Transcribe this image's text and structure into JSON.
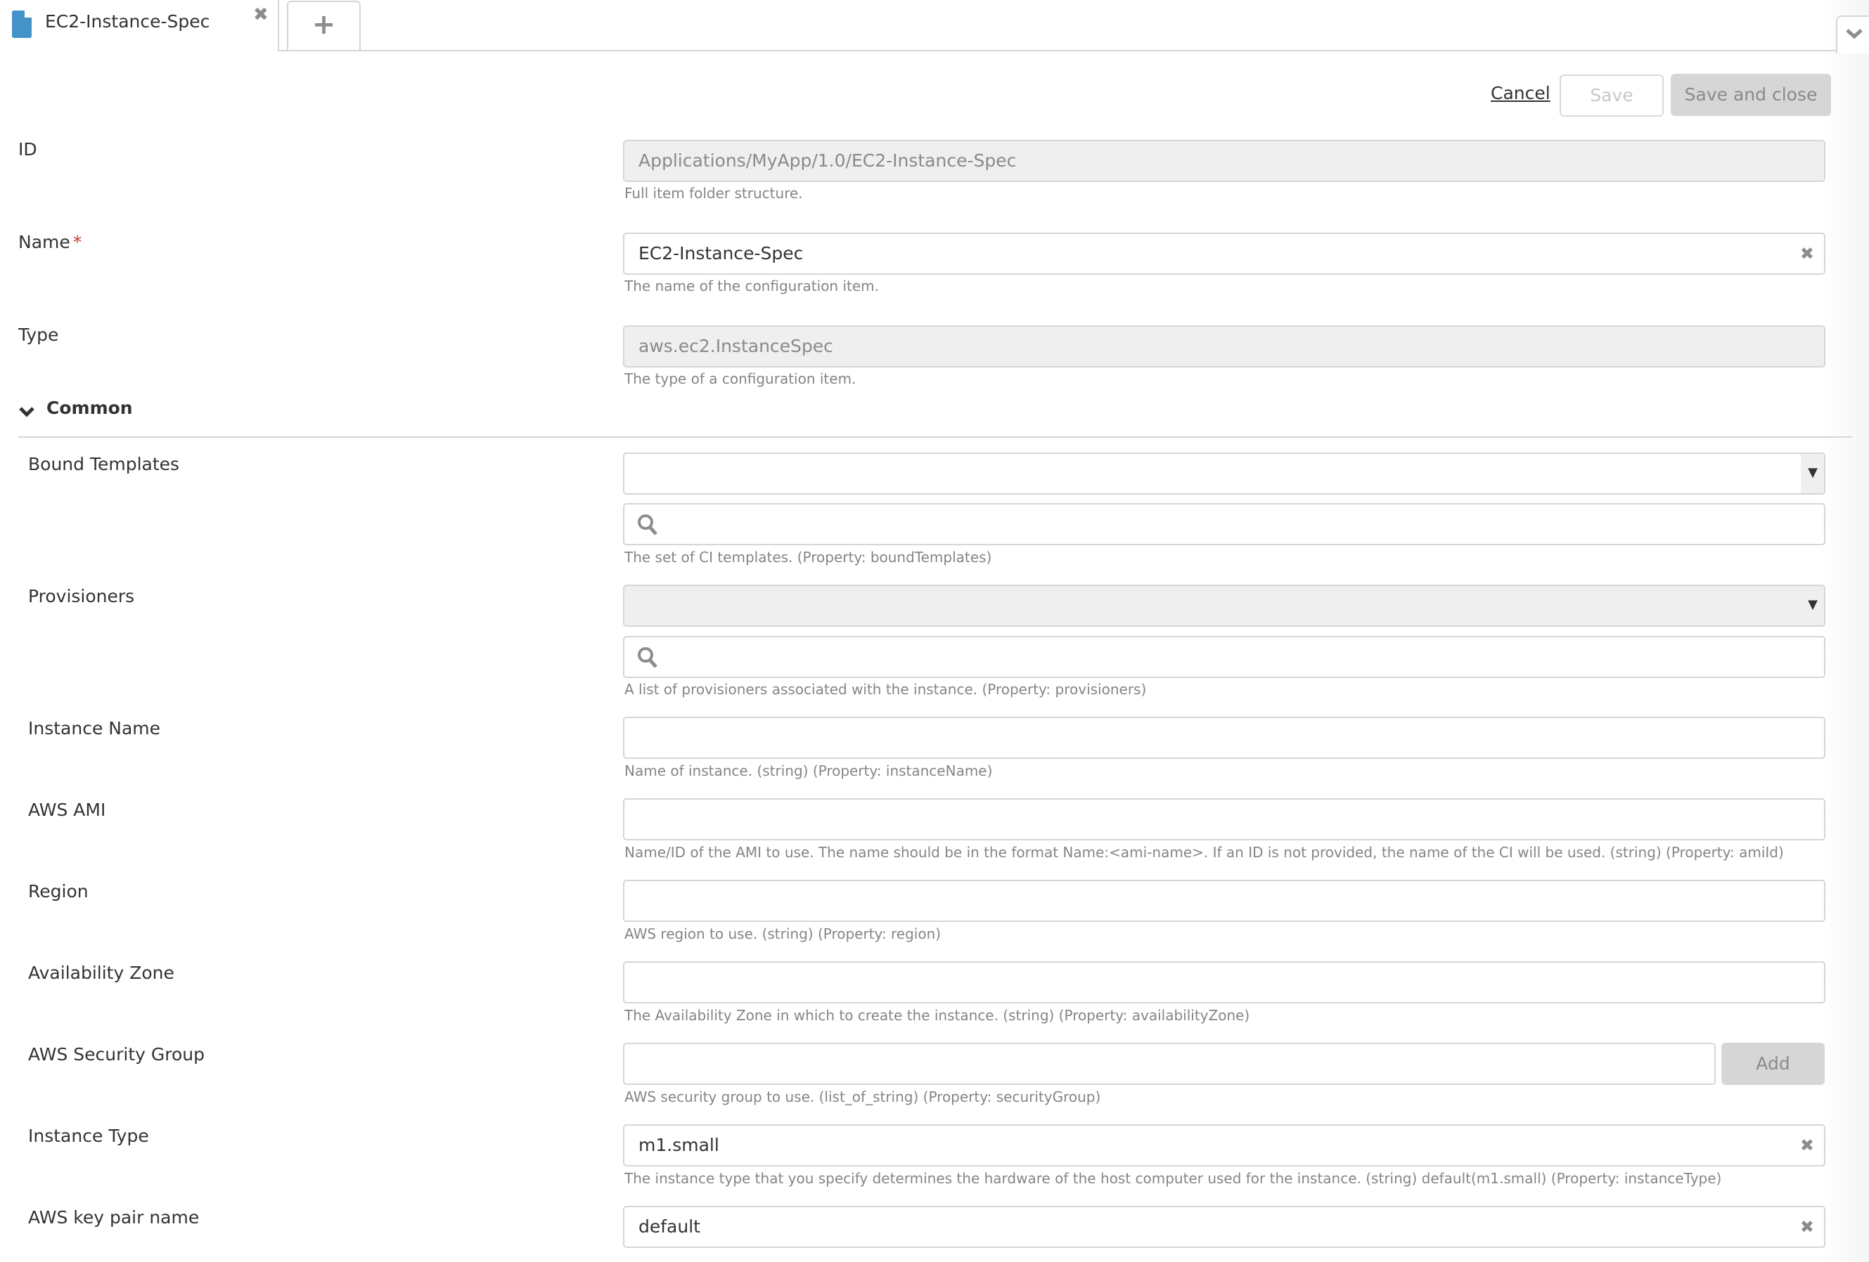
{
  "tabs": {
    "active": {
      "label": "EC2-Instance-Spec",
      "icon": "document-icon",
      "close_icon": "close-icon"
    },
    "add_icon": "plus-icon",
    "menu_icon": "chevron-down-icon"
  },
  "colors": {
    "accent": "#4393c8",
    "required": "#c0392b",
    "border": "#d6d6d6",
    "disabled_bg": "#efefef"
  },
  "actions": {
    "cancel": "Cancel",
    "save": "Save",
    "save_and_close": "Save and close"
  },
  "fields": {
    "id": {
      "label": "ID",
      "value": "Applications/MyApp/1.0/EC2-Instance-Spec",
      "helper": "Full item folder structure."
    },
    "name": {
      "label": "Name",
      "required_mark": "*",
      "value": "EC2-Instance-Spec",
      "helper": "The name of the configuration item."
    },
    "type": {
      "label": "Type",
      "value": "aws.ec2.InstanceSpec",
      "helper": "The type of a configuration item."
    }
  },
  "section": {
    "title": "Common",
    "expanded": true
  },
  "common": {
    "bound_templates": {
      "label": "Bound Templates",
      "selected": "",
      "search_value": "",
      "helper": "The set of CI templates. (Property: boundTemplates)"
    },
    "provisioners": {
      "label": "Provisioners",
      "selected": "",
      "search_value": "",
      "helper": "A list of provisioners associated with the instance. (Property: provisioners)"
    },
    "instance_name": {
      "label": "Instance Name",
      "value": "",
      "helper": "Name of instance. (string) (Property: instanceName)"
    },
    "aws_ami": {
      "label": "AWS AMI",
      "value": "",
      "helper": "Name/ID of the AMI to use. The name should be in the format Name:<ami-name>. If an ID is not provided, the name of the CI will be used. (string) (Property: amiId)"
    },
    "region": {
      "label": "Region",
      "value": "",
      "helper": "AWS region to use. (string) (Property: region)"
    },
    "availability_zone": {
      "label": "Availability Zone",
      "value": "",
      "helper": "The Availability Zone in which to create the instance. (string) (Property: availabilityZone)"
    },
    "security_group": {
      "label": "AWS Security Group",
      "value": "",
      "add_label": "Add",
      "helper": "AWS security group to use. (list_of_string) (Property: securityGroup)"
    },
    "instance_type": {
      "label": "Instance Type",
      "value": "m1.small",
      "helper": "The instance type that you specify determines the hardware of the host computer used for the instance. (string) default(m1.small) (Property: instanceType)"
    },
    "key_pair": {
      "label": "AWS key pair name",
      "value": "default"
    }
  }
}
